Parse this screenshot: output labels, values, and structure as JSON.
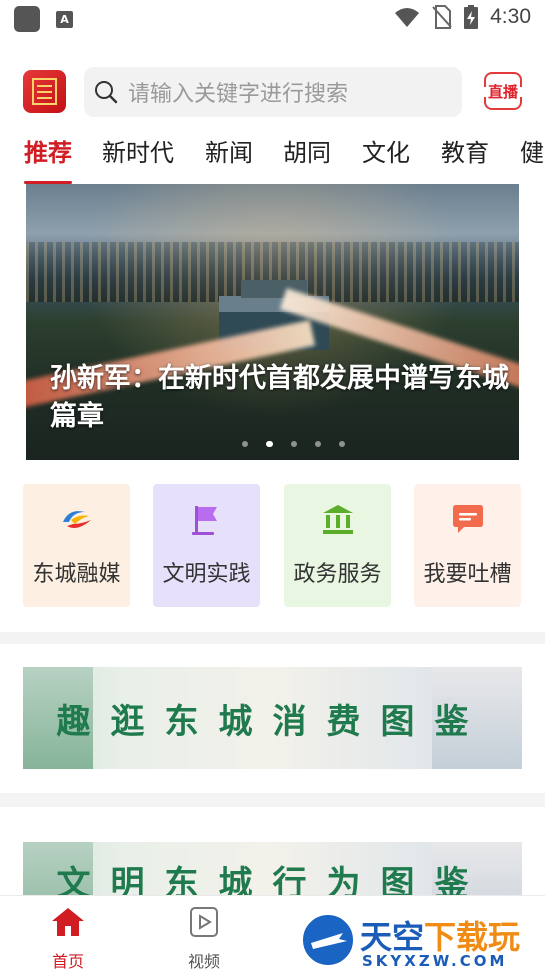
{
  "status_bar": {
    "time": "4:30"
  },
  "header": {
    "search_placeholder": "请输入关键字进行搜索",
    "live_label": "直播"
  },
  "tabs": [
    {
      "label": "推荐",
      "active": true
    },
    {
      "label": "新时代",
      "active": false
    },
    {
      "label": "新闻",
      "active": false
    },
    {
      "label": "胡同",
      "active": false
    },
    {
      "label": "文化",
      "active": false
    },
    {
      "label": "教育",
      "active": false
    },
    {
      "label": "健",
      "active": false
    }
  ],
  "banner": {
    "caption": "孙新军：在新时代首都发展中谱写东城篇章",
    "slides": 5,
    "active_slide": 2
  },
  "quick_entries": [
    {
      "label": "东城融媒",
      "icon": "rongmei-logo-icon",
      "bg": "#fdefe1"
    },
    {
      "label": "文明实践",
      "icon": "flag-icon",
      "bg": "#e6e0fb"
    },
    {
      "label": "政务服务",
      "icon": "government-building-icon",
      "bg": "#e9f7e2"
    },
    {
      "label": "我要吐槽",
      "icon": "chat-bubble-icon",
      "bg": "#fef1ea"
    }
  ],
  "promos": [
    {
      "text": "趣逛东城消费图鉴"
    },
    {
      "text": "文明东城行为图鉴"
    }
  ],
  "bottom_nav": [
    {
      "label": "首页",
      "icon": "home-icon",
      "active": true
    },
    {
      "label": "视频",
      "icon": "video-play-icon",
      "active": false
    }
  ],
  "watermark": {
    "title_main": "天空",
    "title_accent": "下载玩",
    "subtitle": "SKYXZW.COM"
  },
  "colors": {
    "brand_red": "#d01d24",
    "promo_green": "#1f7a4d"
  }
}
